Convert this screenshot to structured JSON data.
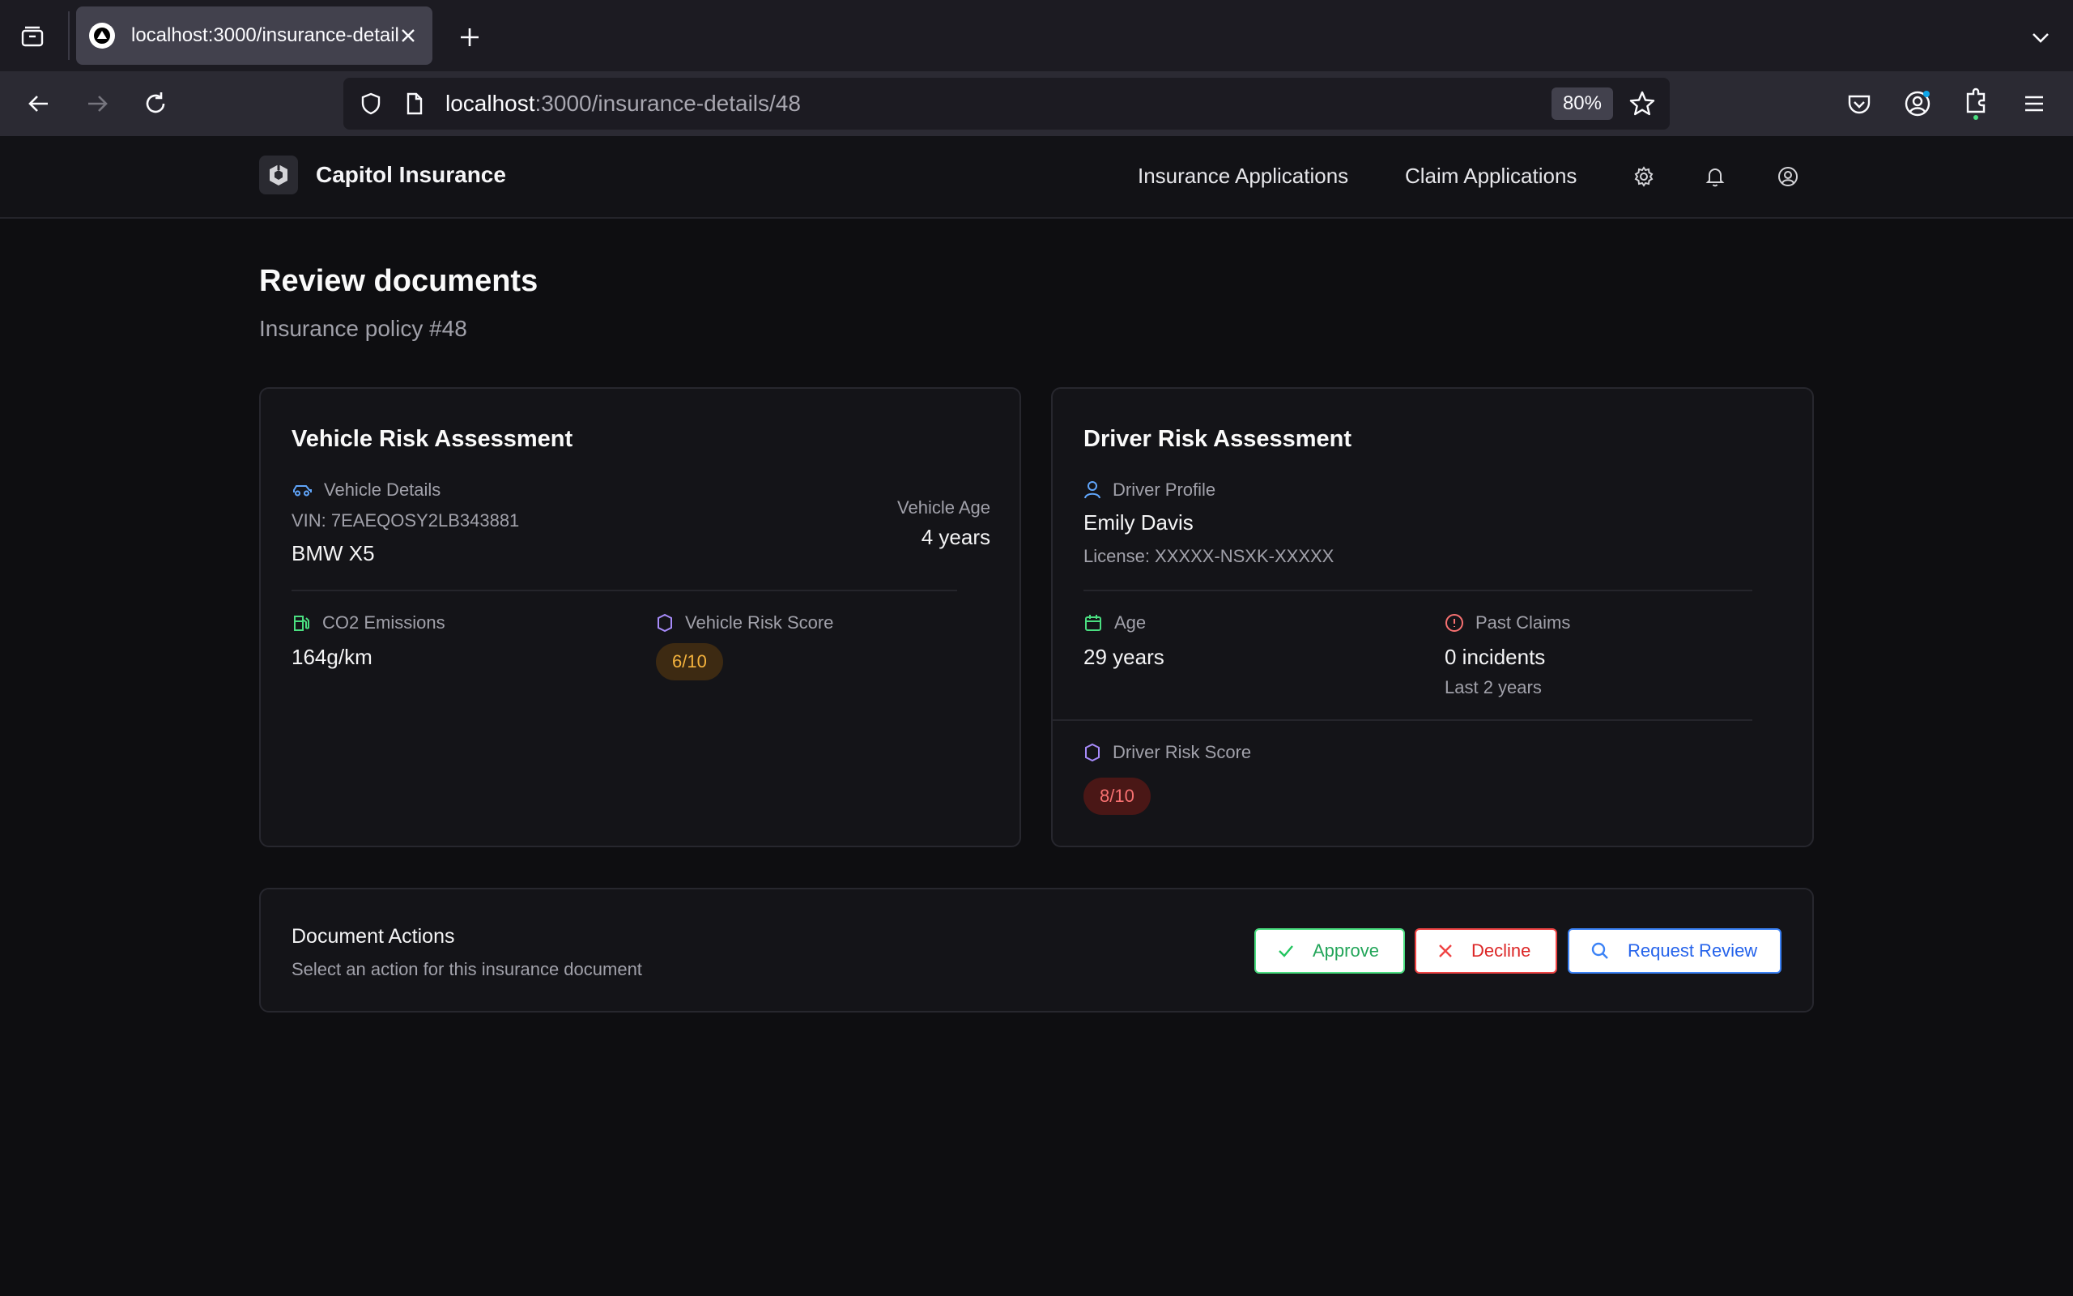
{
  "browser": {
    "tab_title": "localhost:3000/insurance-details/48",
    "url_host": "localhost",
    "url_path": ":3000/insurance-details/48",
    "zoom": "80%"
  },
  "header": {
    "brand": "Capitol Insurance",
    "nav": [
      "Insurance Applications",
      "Claim Applications"
    ],
    "icons": [
      "gear-icon",
      "bell-icon",
      "user-circle-icon"
    ]
  },
  "page": {
    "title": "Review documents",
    "subtitle": "Insurance policy #48"
  },
  "vehicle": {
    "title": "Vehicle Risk Assessment",
    "details_label": "Vehicle Details",
    "vin": "VIN: 7EAEQOSY2LB343881",
    "model": "BMW X5",
    "age_label": "Vehicle Age",
    "age_value": "4 years",
    "co2_label": "CO2 Emissions",
    "co2_value": "164g/km",
    "risk_label": "Vehicle Risk Score",
    "risk_value": "6/10"
  },
  "driver": {
    "title": "Driver Risk Assessment",
    "profile_label": "Driver Profile",
    "name": "Emily Davis",
    "license": "License: XXXXX-NSXK-XXXXX",
    "age_label": "Age",
    "age_value": "29 years",
    "claims_label": "Past Claims",
    "claims_value": "0 incidents",
    "claims_period": "Last 2 years",
    "risk_label": "Driver Risk Score",
    "risk_value": "8/10"
  },
  "actions": {
    "title": "Document Actions",
    "subtitle": "Select an action for this insurance document",
    "approve": "Approve",
    "decline": "Decline",
    "review": "Request Review"
  },
  "colors": {
    "accent_green": "#22c55e",
    "accent_red": "#ef4444",
    "accent_blue": "#3b82f6",
    "accent_purple": "#a78bfa",
    "badge_amber": "#f5b33d"
  }
}
